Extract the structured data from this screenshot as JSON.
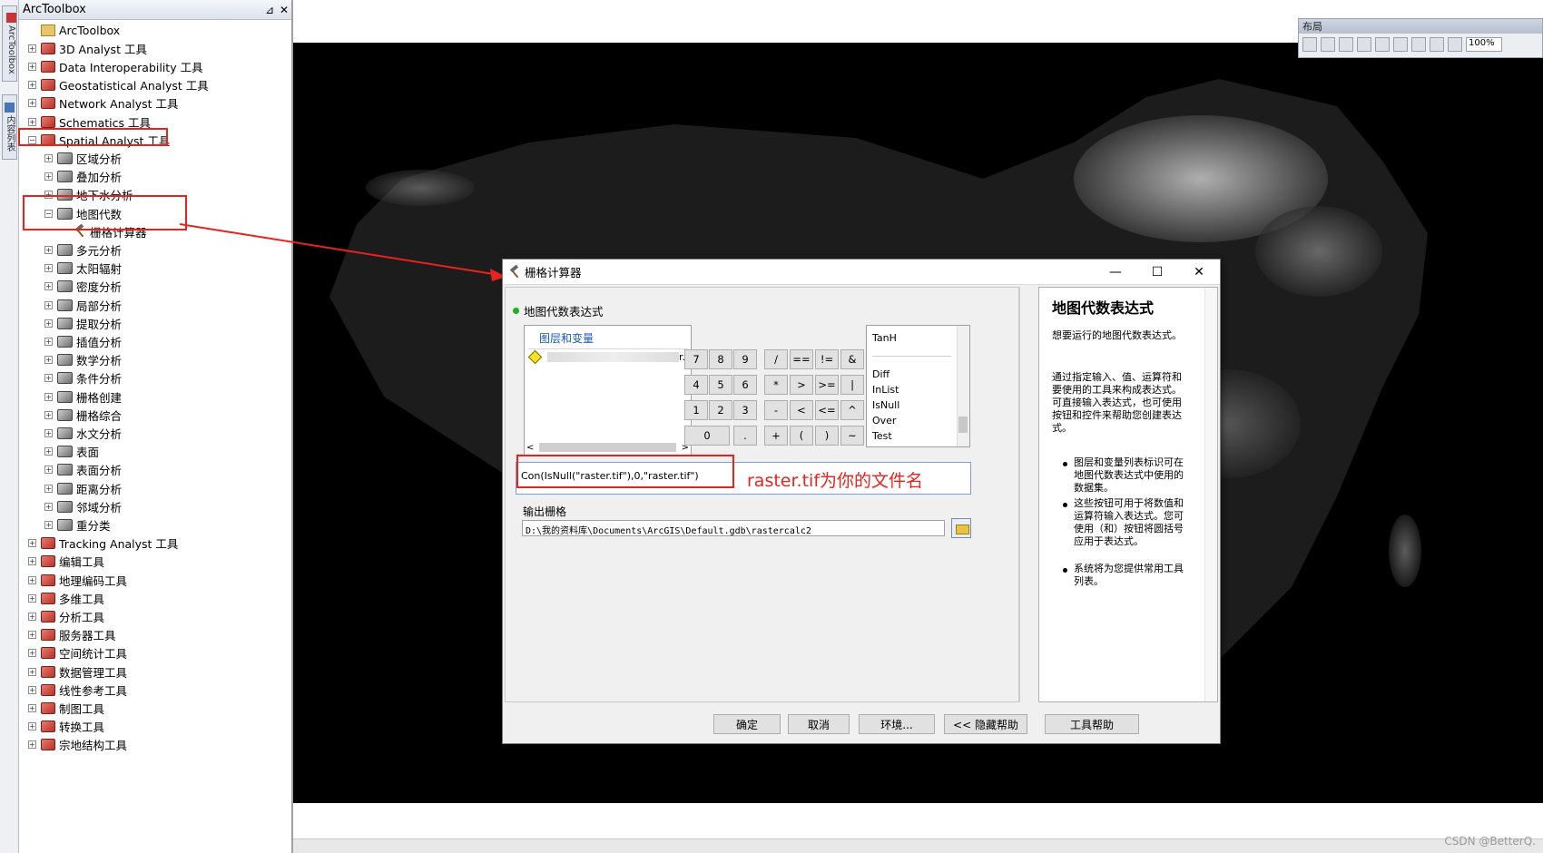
{
  "sidebar_tabs": [
    "ArcToolbox",
    "内容列表"
  ],
  "toolbox": {
    "title": "ArcToolbox",
    "root": "ArcToolbox",
    "items": [
      "3D Analyst 工具",
      "Data Interoperability 工具",
      "Geostatistical Analyst 工具",
      "Network Analyst 工具",
      "Schematics 工具",
      "Spatial Analyst 工具"
    ],
    "spatial_children": [
      "区域分析",
      "叠加分析",
      "地下水分析",
      "地图代数"
    ],
    "map_algebra_child": "栅格计算器",
    "spatial_children_after": [
      "多元分析",
      "太阳辐射",
      "密度分析",
      "局部分析",
      "提取分析",
      "插值分析",
      "数学分析",
      "条件分析",
      "栅格创建",
      "栅格综合",
      "水文分析",
      "表面",
      "表面分析",
      "距离分析",
      "邻域分析",
      "重分类"
    ],
    "items_after": [
      "Tracking Analyst 工具",
      "编辑工具",
      "地理编码工具",
      "多维工具",
      "分析工具",
      "服务器工具",
      "空间统计工具",
      "数据管理工具",
      "线性参考工具",
      "制图工具",
      "转换工具",
      "宗地结构工具"
    ]
  },
  "layout_toolbar": {
    "title": "布局",
    "zoom": "100%"
  },
  "dialog": {
    "title": "栅格计算器",
    "section": "地图代数表达式",
    "layers_header": "图层和变量",
    "layer_suffix": "r.t",
    "keys": [
      "7",
      "8",
      "9",
      "/",
      "==",
      "!=",
      "&",
      "4",
      "5",
      "6",
      "*",
      ">",
      ">=",
      "|",
      "1",
      "2",
      "3",
      "-",
      "<",
      "<=",
      "^",
      "0",
      ".",
      "+",
      "(",
      ")",
      "~"
    ],
    "functions": [
      "TanH",
      "Diff",
      "InList",
      "IsNull",
      "Over",
      "Test"
    ],
    "expression": "Con(IsNull(\"raster.tif\"),0,\"raster.tif\")",
    "annotation": "raster.tif为你的文件名",
    "output_label": "输出栅格",
    "output_path": "D:\\我的资料库\\Documents\\ArcGIS\\Default.gdb\\rastercalc2",
    "buttons": [
      "确定",
      "取消",
      "环境...",
      "<< 隐藏帮助",
      "工具帮助"
    ],
    "help": {
      "title": "地图代数表达式",
      "p1": "想要运行的地图代数表达式。",
      "p2": "通过指定输入、值、运算符和要使用的工具来构成表达式。可直接输入表达式，也可使用按钮和控件来帮助您创建表达式。",
      "b1": "图层和变量列表标识可在地图代数表达式中使用的数据集。",
      "b2": "这些按钮可用于将数值和运算符输入表达式。您可使用（和）按钮将圆括号应用于表达式。",
      "b3": "系统将为您提供常用工具列表。"
    }
  },
  "watermark": "CSDN @BetterQ.",
  "colors": {
    "highlight": "#e8231d",
    "help_link": "#1e56b5"
  }
}
